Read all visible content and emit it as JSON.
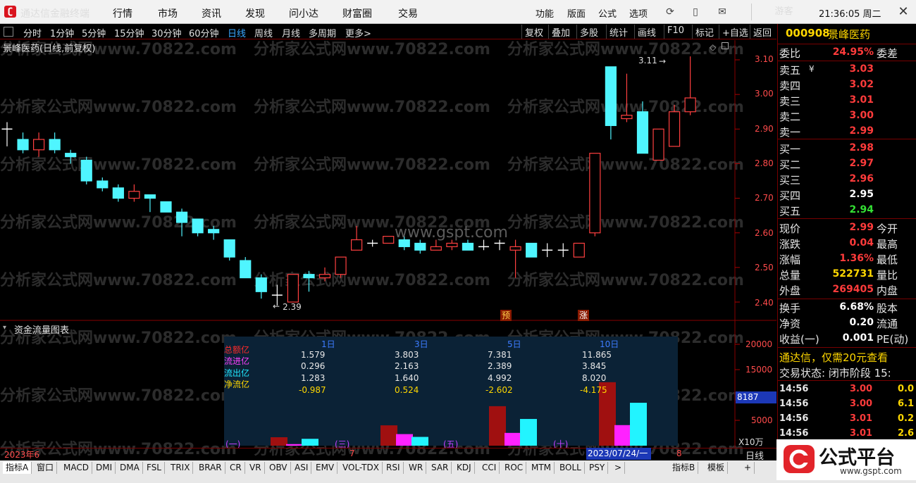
{
  "app": {
    "title": "通达信金融终端",
    "menu": [
      "行情",
      "市场",
      "资讯",
      "发现",
      "问小达",
      "财富圈",
      "交易"
    ],
    "right_menu": [
      "功能",
      "版面",
      "公式",
      "选项"
    ],
    "user": "游客",
    "clock": "21:36:05 周二"
  },
  "toolbar": {
    "periods": [
      "分时",
      "1分钟",
      "5分钟",
      "15分钟",
      "30分钟",
      "60分钟",
      "日线",
      "周线",
      "月线",
      "多周期",
      "更多>"
    ],
    "active_period": "日线",
    "right_buttons": [
      "复权",
      "叠加",
      "多股",
      "统计",
      "画线",
      "F10",
      "标记",
      "+自选",
      "返回"
    ]
  },
  "chart": {
    "stock_title": "景峰医药(日线,前复权)",
    "price_axis": [
      "3.10",
      "3.00",
      "2.90",
      "2.80",
      "2.70",
      "2.60",
      "2.50",
      "2.40"
    ],
    "high_marker": "3.11",
    "low_marker": "2.39",
    "tag_forecast": "预",
    "tag_limit": "涨",
    "watermark_text": "分析家公式网www.70822.com",
    "center_watermark": "www.gspt.com",
    "subchart_title": "资金流量图表",
    "volume_axis": [
      "20000",
      "15000",
      "10000",
      "5000"
    ],
    "volume_current": "8187",
    "volume_unit": "X10万"
  },
  "flow_table": {
    "row_labels": [
      "总额亿",
      "流进亿",
      "流出亿",
      "净流亿"
    ],
    "columns": [
      {
        "head": "1日",
        "values": [
          "1.579",
          "0.296",
          "1.283",
          "-0.987"
        ]
      },
      {
        "head": "3日",
        "values": [
          "3.803",
          "2.163",
          "1.640",
          "0.524"
        ]
      },
      {
        "head": "5日",
        "values": [
          "7.381",
          "2.389",
          "4.992",
          "-2.602"
        ]
      },
      {
        "head": "10日",
        "values": [
          "11.865",
          "3.845",
          "8.020",
          "-4.175"
        ]
      }
    ],
    "group_labels": [
      "(一)",
      "(三)",
      "(五)",
      "(十)"
    ]
  },
  "datebar": {
    "left_label": "2023年6",
    "mid_label": "7",
    "cursor": "2023/07/24/一",
    "right_label": "8",
    "day_button": "日线"
  },
  "indicators": [
    "指标A",
    "窗口",
    "MACD",
    "DMI",
    "DMA",
    "FSL",
    "TRIX",
    "BRAR",
    "CR",
    "VR",
    "OBV",
    "ASI",
    "EMV",
    "VOL-TDX",
    "RSI",
    "WR",
    "SAR",
    "KDJ",
    "CCI",
    "ROC",
    "MTM",
    "BOLL",
    "PSY",
    ">",
    "指标B",
    "模板",
    "+"
  ],
  "quote": {
    "code": "000908",
    "name": "景峰医药",
    "weibi_label": "委比",
    "weibi": "24.95%",
    "weicha_label": "委差",
    "asks": [
      {
        "label": "卖五",
        "price": "3.03"
      },
      {
        "label": "卖四",
        "price": "3.02"
      },
      {
        "label": "卖三",
        "price": "3.01"
      },
      {
        "label": "卖二",
        "price": "3.00"
      },
      {
        "label": "卖一",
        "price": "2.99"
      }
    ],
    "bids": [
      {
        "label": "买一",
        "price": "2.98"
      },
      {
        "label": "买二",
        "price": "2.97"
      },
      {
        "label": "买三",
        "price": "2.96"
      },
      {
        "label": "买四",
        "price": "2.95"
      },
      {
        "label": "买五",
        "price": "2.94"
      }
    ],
    "stats": [
      {
        "label": "现价",
        "value": "2.99",
        "right": "今开"
      },
      {
        "label": "涨跌",
        "value": "0.04",
        "right": "最高"
      },
      {
        "label": "涨幅",
        "value": "1.36%",
        "right": "最低"
      },
      {
        "label": "总量",
        "value": "522731",
        "right": "量比"
      },
      {
        "label": "外盘",
        "value": "269405",
        "right": "内盘"
      }
    ],
    "stats2": [
      {
        "label": "换手",
        "value": "6.68%",
        "right": "股本"
      },
      {
        "label": "净资",
        "value": "0.20",
        "right": "流通"
      },
      {
        "label": "收益(一)",
        "value": "0.001",
        "right": "PE(动)"
      }
    ],
    "promo": "通达信，仅需20元查看",
    "trade_state": "交易状态: 闭市阶段 15:",
    "ticks": [
      {
        "time": "14:56",
        "price": "3.00",
        "vol": "0.0"
      },
      {
        "time": "14:56",
        "price": "3.00",
        "vol": "6.1"
      },
      {
        "time": "14:56",
        "price": "3.01",
        "vol": "0.2"
      },
      {
        "time": "14:56",
        "price": "3.01",
        "vol": "2.6"
      }
    ]
  },
  "brand": {
    "name": "公式平台",
    "url": "www.gspt.com"
  },
  "chart_data": {
    "type": "candlestick",
    "y_range": [
      2.36,
      3.14
    ],
    "candles": [
      {
        "o": 2.9,
        "c": 2.9,
        "h": 2.92,
        "l": 2.85
      },
      {
        "o": 2.87,
        "c": 2.84,
        "h": 2.89,
        "l": 2.83
      },
      {
        "o": 2.84,
        "c": 2.87,
        "h": 2.89,
        "l": 2.82
      },
      {
        "o": 2.87,
        "c": 2.84,
        "h": 2.89,
        "l": 2.83
      },
      {
        "o": 2.83,
        "c": 2.82,
        "h": 2.84,
        "l": 2.8
      },
      {
        "o": 2.81,
        "c": 2.75,
        "h": 2.82,
        "l": 2.74
      },
      {
        "o": 2.75,
        "c": 2.73,
        "h": 2.76,
        "l": 2.72
      },
      {
        "o": 2.73,
        "c": 2.7,
        "h": 2.74,
        "l": 2.69
      },
      {
        "o": 2.7,
        "c": 2.72,
        "h": 2.74,
        "l": 2.69
      },
      {
        "o": 2.71,
        "c": 2.7,
        "h": 2.71,
        "l": 2.66
      },
      {
        "o": 2.69,
        "c": 2.66,
        "h": 2.69,
        "l": 2.66
      },
      {
        "o": 2.66,
        "c": 2.63,
        "h": 2.67,
        "l": 2.59
      },
      {
        "o": 2.64,
        "c": 2.6,
        "h": 2.64,
        "l": 2.59
      },
      {
        "o": 2.61,
        "c": 2.6,
        "h": 2.62,
        "l": 2.58
      },
      {
        "o": 2.58,
        "c": 2.53,
        "h": 2.58,
        "l": 2.52
      },
      {
        "o": 2.52,
        "c": 2.47,
        "h": 2.53,
        "l": 2.47
      },
      {
        "o": 2.47,
        "c": 2.43,
        "h": 2.48,
        "l": 2.41
      },
      {
        "o": 2.42,
        "c": 2.42,
        "h": 2.45,
        "l": 2.39
      },
      {
        "o": 2.4,
        "c": 2.48,
        "h": 2.48,
        "l": 2.4
      },
      {
        "o": 2.48,
        "c": 2.47,
        "h": 2.49,
        "l": 2.43
      },
      {
        "o": 2.47,
        "c": 2.48,
        "h": 2.5,
        "l": 2.46
      },
      {
        "o": 2.48,
        "c": 2.53,
        "h": 2.53,
        "l": 2.47
      },
      {
        "o": 2.55,
        "c": 2.58,
        "h": 2.62,
        "l": 2.55
      },
      {
        "o": 2.57,
        "c": 2.57,
        "h": 2.58,
        "l": 2.56
      },
      {
        "o": 2.57,
        "c": 2.59,
        "h": 2.59,
        "l": 2.57
      },
      {
        "o": 2.58,
        "c": 2.56,
        "h": 2.59,
        "l": 2.55
      },
      {
        "o": 2.57,
        "c": 2.55,
        "h": 2.58,
        "l": 2.54
      },
      {
        "o": 2.55,
        "c": 2.56,
        "h": 2.58,
        "l": 2.55
      },
      {
        "o": 2.56,
        "c": 2.57,
        "h": 2.58,
        "l": 2.55
      },
      {
        "o": 2.57,
        "c": 2.55,
        "h": 2.58,
        "l": 2.55
      },
      {
        "o": 2.56,
        "c": 2.56,
        "h": 2.58,
        "l": 2.55
      },
      {
        "o": 2.57,
        "c": 2.57,
        "h": 2.58,
        "l": 2.55
      },
      {
        "o": 2.55,
        "c": 2.56,
        "h": 2.58,
        "l": 2.47
      },
      {
        "o": 2.57,
        "c": 2.53,
        "h": 2.57,
        "l": 2.53
      },
      {
        "o": 2.55,
        "c": 2.55,
        "h": 2.57,
        "l": 2.53
      },
      {
        "o": 2.55,
        "c": 2.55,
        "h": 2.57,
        "l": 2.53
      },
      {
        "o": 2.53,
        "c": 2.57,
        "h": 2.57,
        "l": 2.53
      },
      {
        "o": 2.6,
        "c": 2.83,
        "h": 2.83,
        "l": 2.59
      },
      {
        "o": 3.08,
        "c": 2.91,
        "h": 3.08,
        "l": 2.87
      },
      {
        "o": 2.93,
        "c": 2.94,
        "h": 3.06,
        "l": 2.92
      },
      {
        "o": 2.95,
        "c": 2.83,
        "h": 2.98,
        "l": 2.83
      },
      {
        "o": 2.81,
        "c": 2.9,
        "h": 2.9,
        "l": 2.81
      },
      {
        "o": 2.85,
        "c": 2.95,
        "h": 2.97,
        "l": 2.85
      },
      {
        "o": 2.95,
        "c": 2.99,
        "h": 3.11,
        "l": 2.94
      }
    ],
    "flow_bars": [
      {
        "period": "1日",
        "total": 1.579,
        "inflow": 0.296,
        "outflow": 1.283
      },
      {
        "period": "3日",
        "total": 3.803,
        "inflow": 2.163,
        "outflow": 1.64
      },
      {
        "period": "5日",
        "total": 7.381,
        "inflow": 2.389,
        "outflow": 4.992
      },
      {
        "period": "10日",
        "total": 11.865,
        "inflow": 3.845,
        "outflow": 8.02
      }
    ]
  }
}
